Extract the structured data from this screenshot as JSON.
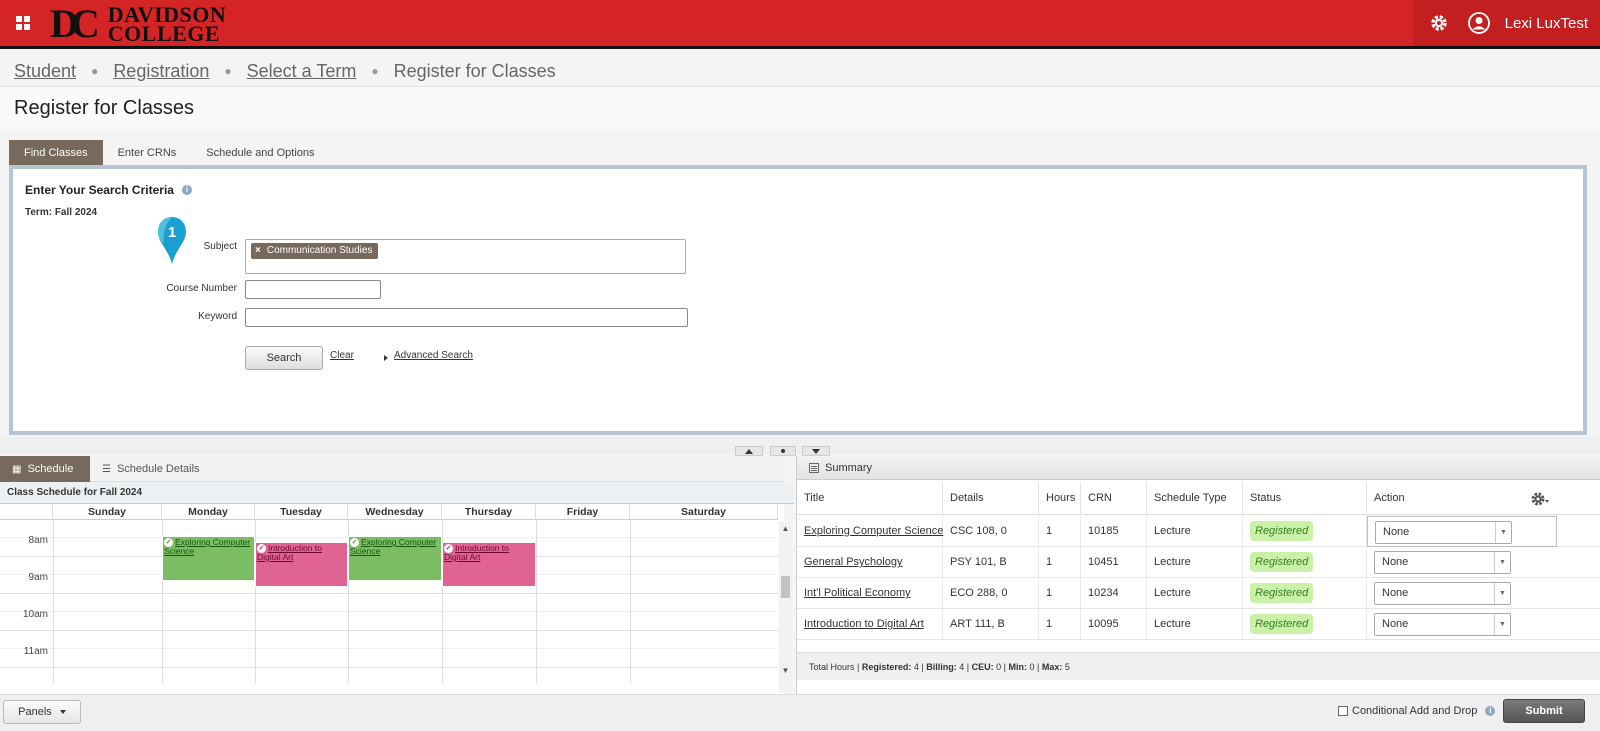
{
  "header": {
    "logo_mark": "DC",
    "logo_line1": "DAVIDSON",
    "logo_line2": "COLLEGE",
    "user_name": "Lexi LuxTest",
    "brand_color": "#d42426"
  },
  "breadcrumb": {
    "items": [
      "Student",
      "Registration",
      "Select a Term"
    ],
    "current": "Register for Classes"
  },
  "page_title": "Register for Classes",
  "tabs": [
    "Find Classes",
    "Enter CRNs",
    "Schedule and Options"
  ],
  "search": {
    "title": "Enter Your Search Criteria",
    "term": "Term: Fall 2024",
    "pin_number": "1",
    "subject_label": "Subject",
    "subject_chip": "Communication Studies",
    "course_number_label": "Course Number",
    "course_number_value": "",
    "keyword_label": "Keyword",
    "keyword_value": "",
    "search_button": "Search",
    "clear_link": "Clear",
    "advanced_link": "Advanced Search"
  },
  "schedule": {
    "tab_schedule": "Schedule",
    "tab_details": "Schedule Details",
    "title": "Class Schedule for Fall 2024",
    "days": [
      "Sunday",
      "Monday",
      "Tuesday",
      "Wednesday",
      "Thursday",
      "Friday",
      "Saturday"
    ],
    "times": [
      "8am",
      "9am",
      "10am",
      "11am"
    ],
    "events": [
      {
        "day": "Monday",
        "title": "Exploring Computer Science",
        "color": "green"
      },
      {
        "day": "Tuesday",
        "title": "Introduction to Digital Art",
        "color": "pink"
      },
      {
        "day": "Wednesday",
        "title": "Exploring Computer Science",
        "color": "green"
      },
      {
        "day": "Thursday",
        "title": "Introduction to Digital Art",
        "color": "pink"
      }
    ]
  },
  "summary": {
    "title": "Summary",
    "columns": [
      "Title",
      "Details",
      "Hours",
      "CRN",
      "Schedule Type",
      "Status",
      "Action"
    ],
    "rows": [
      {
        "title": "Exploring Computer Science",
        "details": "CSC 108, 0",
        "hours": "1",
        "crn": "10185",
        "type": "Lecture",
        "status": "Registered",
        "action": "None"
      },
      {
        "title": "General Psychology",
        "details": "PSY 101, B",
        "hours": "1",
        "crn": "10451",
        "type": "Lecture",
        "status": "Registered",
        "action": "None"
      },
      {
        "title": "Int'l Political Economy",
        "details": "ECO 288, 0",
        "hours": "1",
        "crn": "10234",
        "type": "Lecture",
        "status": "Registered",
        "action": "None"
      },
      {
        "title": "Introduction to Digital Art",
        "details": "ART 111, B",
        "hours": "1",
        "crn": "10095",
        "type": "Lecture",
        "status": "Registered",
        "action": "None"
      }
    ],
    "footer": {
      "total_hours_label": "Total Hours",
      "registered_label": "Registered:",
      "registered": "4",
      "billing_label": "Billing:",
      "billing": "4",
      "ceu_label": "CEU:",
      "ceu": "0",
      "min_label": "Min:",
      "min": "0",
      "max_label": "Max:",
      "max": "5"
    }
  },
  "bottom": {
    "panels_button": "Panels",
    "conditional_label": "Conditional Add and Drop",
    "submit_button": "Submit"
  }
}
